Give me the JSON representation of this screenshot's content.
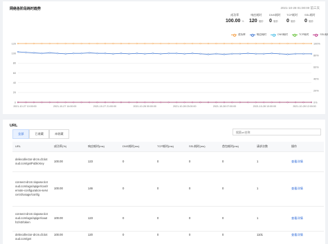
{
  "trend": {
    "title": "网络各阶段耗时趋势",
    "time_range": "2021-10-28 01:00:00 前三天",
    "metrics": [
      {
        "label": "成功率",
        "value": "100.00",
        "unit": "%"
      },
      {
        "label": "响应耗时",
        "value": "120",
        "unit": "毫秒"
      },
      {
        "label": "DNS耗时",
        "value": "0",
        "unit": "毫秒"
      },
      {
        "label": "TCP耗时",
        "value": "0",
        "unit": "毫秒"
      },
      {
        "label": "SSL耗时",
        "value": "0",
        "unit": "毫秒"
      }
    ]
  },
  "chart_data": {
    "type": "line",
    "x": [
      "2021-10-27 10:00:00",
      "2021-10-27 14:00:00",
      "2021-10-27 21:00:00",
      "2021-10-28 00:00:00",
      "2021-10-28 03:00:00",
      "2021-10-28 07:00:00",
      "2021-10-28 10:00:00",
      "2021-10-28 12:00:00"
    ],
    "x_ticks": [
      "2021-10-27 10:00:00",
      "2021-10-27 14:00:00",
      "2021-10-27 21:00:00",
      "2021-10-28 00:00:00",
      "2021-10-28 03:00:00",
      "2021-10-28 07:00:00",
      "2021-10-28 10:00:00",
      "2021-10-28 12:00:00"
    ],
    "y_left_ticks": [
      "0",
      "20",
      "40",
      "60",
      "80",
      "100",
      "120"
    ],
    "y_right_ticks": [
      "0%",
      "20%",
      "40%",
      "60%",
      "80%",
      "100%"
    ],
    "ylim_left": [
      0,
      120
    ],
    "ylim_right": [
      0,
      100
    ],
    "grid": true,
    "legend_position": "top-right",
    "series": [
      {
        "name": "成功率",
        "axis": "right",
        "color": "#f5a24b",
        "values": [
          100,
          100,
          100,
          100,
          100,
          100,
          100,
          100,
          100,
          100,
          100,
          100,
          100,
          100,
          100,
          100,
          100,
          100,
          100,
          100,
          100,
          100,
          100,
          100,
          100,
          100,
          100,
          100,
          100,
          100,
          100,
          100,
          100,
          100,
          100,
          100,
          100,
          100
        ]
      },
      {
        "name": "响应耗时",
        "axis": "left",
        "color": "#4a7fd6",
        "values": [
          103,
          102,
          101,
          100,
          101,
          100,
          99,
          100,
          100,
          101,
          100,
          100,
          99,
          100,
          99,
          100,
          99,
          100,
          99,
          100,
          100,
          99,
          100,
          99,
          98,
          99,
          98,
          99,
          99,
          100,
          99,
          99,
          100,
          99,
          98,
          99,
          99,
          99
        ]
      },
      {
        "name": "DNS耗时",
        "axis": "left",
        "color": "#4fc0e8",
        "values": [
          0,
          0,
          0,
          0,
          0,
          0,
          0,
          0,
          0,
          0,
          0,
          0,
          0,
          0,
          0,
          0,
          0,
          0,
          0,
          0,
          0,
          0,
          0,
          0,
          0,
          0,
          0,
          0,
          0,
          0,
          0,
          0,
          0,
          0,
          0,
          0,
          0,
          0
        ]
      },
      {
        "name": "TCP耗时",
        "axis": "left",
        "color": "#67c23a",
        "values": [
          0,
          0,
          0,
          0,
          0,
          0,
          0,
          0,
          0,
          0,
          0,
          0,
          0,
          0,
          0,
          0,
          0,
          0,
          0,
          0,
          0,
          0,
          0,
          0,
          0,
          0,
          0,
          0,
          0,
          0,
          0,
          0,
          0,
          0,
          0,
          0,
          0,
          0
        ]
      },
      {
        "name": "SSL耗时",
        "axis": "left",
        "color": "#c03d8c",
        "values": [
          0,
          0,
          0,
          0,
          0,
          0,
          0,
          0,
          0,
          0,
          0,
          0,
          0,
          0,
          0,
          0,
          0,
          0,
          0,
          0,
          0,
          0,
          0,
          0,
          0,
          0,
          0,
          0,
          0,
          0,
          0,
          0,
          0,
          0,
          0,
          0,
          0,
          0
        ]
      }
    ]
  },
  "url_section": {
    "title": "URL",
    "tabs": [
      "全部",
      "已收藏",
      "未收藏"
    ],
    "active_tab": 0,
    "search_placeholder": "搜索url名称",
    "columns": [
      "URL",
      "成功率(%)",
      "响应耗时(ms)",
      "DNS耗时(ms)",
      "TCP耗时(ms)",
      "SSL耗时(ms)",
      "首包耗时(ms)",
      "请求次数",
      "操作"
    ],
    "rows": [
      [
        "deliecollector-drcm.dt.tiotoud.com/getPublicKey",
        "100.00",
        "123",
        "0",
        "0",
        "0",
        "0",
        "1",
        "查看详情"
      ],
      [
        "connect-drcm.tiopase.tiotoud.com/ago/apiger/cas/remote-configuration-service/v2/usage/config",
        "100.00",
        "146",
        "0",
        "0",
        "0",
        "0",
        "1",
        "查看详情"
      ],
      [
        "connect-drcm.tiopase.tiotoud.com/ago/apiger/oauth2/v3/token",
        "100.00",
        "123",
        "0",
        "0",
        "0",
        "0",
        "1",
        "查看详情"
      ],
      [
        "deliecollector-drcm.dt.tiotoud.com/get",
        "100.00",
        "120",
        "0",
        "0",
        "0",
        "0",
        "1101",
        "查看详情"
      ]
    ]
  }
}
